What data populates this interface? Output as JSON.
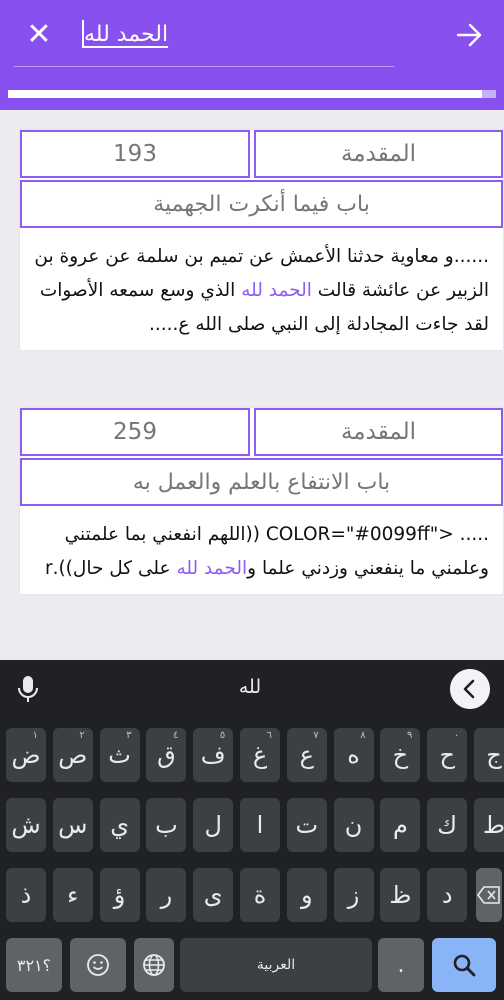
{
  "header": {
    "search_text": "الحمد لله",
    "close_icon": "close-icon",
    "submit_icon": "arrow-right-icon",
    "colors": {
      "header_bg": "#8950f0",
      "accent": "#8d5cf0"
    }
  },
  "results": [
    {
      "section": "المقدمة",
      "number": "193",
      "chapter": "باب فيما أنكرت الجهمية",
      "snippet_before": "......و معاوية حدثنا الأعمش عن تميم بن سلمة عن عروة بن الزبير عن عائشة قالت ",
      "snippet_highlight": "الحمد لله",
      "snippet_after": " الذي وسع سمعه الأصوات لقد جاءت المجادلة إلى النبي صلى الله ع....."
    },
    {
      "section": "المقدمة",
      "number": "259",
      "chapter": "باب الانتفاع بالعلم والعمل به",
      "snippet_before": "..... <\"COLOR=\"#0099ff ((اللهم انفعني بما علمتني وعلمني ما ينفعني وزدني علما و",
      "snippet_highlight": "الحمد لله",
      "snippet_after": " على كل حال)).r"
    }
  ],
  "keyboard": {
    "suggestion": "لله",
    "row1": [
      {
        "label": "ض",
        "hint": "١"
      },
      {
        "label": "ص",
        "hint": "٢"
      },
      {
        "label": "ث",
        "hint": "٣"
      },
      {
        "label": "ق",
        "hint": "٤"
      },
      {
        "label": "ف",
        "hint": "٥"
      },
      {
        "label": "غ",
        "hint": "٦"
      },
      {
        "label": "ع",
        "hint": "٧"
      },
      {
        "label": "ه",
        "hint": "٨"
      },
      {
        "label": "خ",
        "hint": "٩"
      },
      {
        "label": "ح",
        "hint": "٠"
      },
      {
        "label": "ج",
        "hint": ""
      }
    ],
    "row2": [
      "ش",
      "س",
      "ي",
      "ب",
      "ل",
      "ا",
      "ت",
      "ن",
      "م",
      "ك",
      "ط"
    ],
    "row3": [
      "ذ",
      "ء",
      "ؤ",
      "ر",
      "ى",
      "ة",
      "و",
      "ز",
      "ظ",
      "د"
    ],
    "symbols_label": "؟٣٢١",
    "space_label": "العربية",
    "emoji_icon": "emoji-icon",
    "globe_icon": "globe-icon",
    "search_icon": "search-icon",
    "backspace_icon": "backspace-icon",
    "mic_icon": "mic-icon",
    "collapse_icon": "chevron-left-icon"
  }
}
